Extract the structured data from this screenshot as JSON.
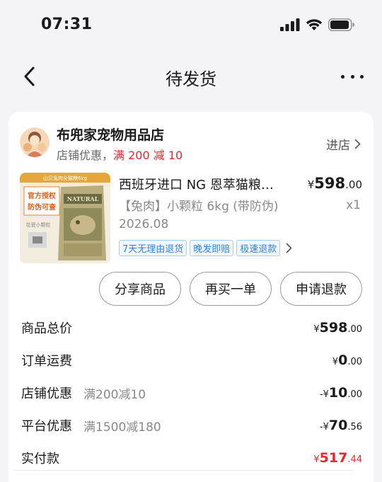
{
  "status_bar": {
    "time": "07:31"
  },
  "nav": {
    "title": "待发货"
  },
  "shop": {
    "name": "布兜家宠物用品店",
    "promo_prefix": "店铺优惠，",
    "promo_highlight": "满 200 减 10",
    "enter_label": "进店"
  },
  "product": {
    "image_label": "山贝兔肉全猫粮6kg",
    "image_badge_line1": "官方授权",
    "image_badge_line2": "防伪可查",
    "image_sub": "花瓷小颗粒",
    "image_brand": "NATURAL",
    "title": "西班牙进口 NG 恩萃猫粮…",
    "variant": "【兔肉】小颗粒 6kg (带防伪) 2026.08",
    "price_symbol": "¥",
    "price_int": "598",
    "price_dec": ".00",
    "qty": "x1",
    "tags": [
      "7天无理由退货",
      "晚发即赔",
      "极速退款"
    ]
  },
  "actions": {
    "share": "分享商品",
    "rebuy": "再买一单",
    "refund": "申请退款"
  },
  "summary": {
    "rows": [
      {
        "label": "商品总价",
        "sub": "",
        "prefix": "",
        "symbol": "¥",
        "int": "598",
        "dec": ".00"
      },
      {
        "label": "订单运费",
        "sub": "",
        "prefix": "",
        "symbol": "¥",
        "int": "0",
        "dec": ".00"
      },
      {
        "label": "店铺优惠",
        "sub": "满200减10",
        "prefix": "-",
        "symbol": "¥",
        "int": "10",
        "dec": ".00"
      },
      {
        "label": "平台优惠",
        "sub": "满1500减180",
        "prefix": "-",
        "symbol": "¥",
        "int": "70",
        "dec": ".56"
      }
    ],
    "paid": {
      "label": "实付款",
      "symbol": "¥",
      "int": "517",
      "dec": ".44"
    }
  },
  "colors": {
    "accent_red": "#e8262e",
    "tag_blue": "#2f7fe0",
    "background": "#f4f4f6"
  }
}
